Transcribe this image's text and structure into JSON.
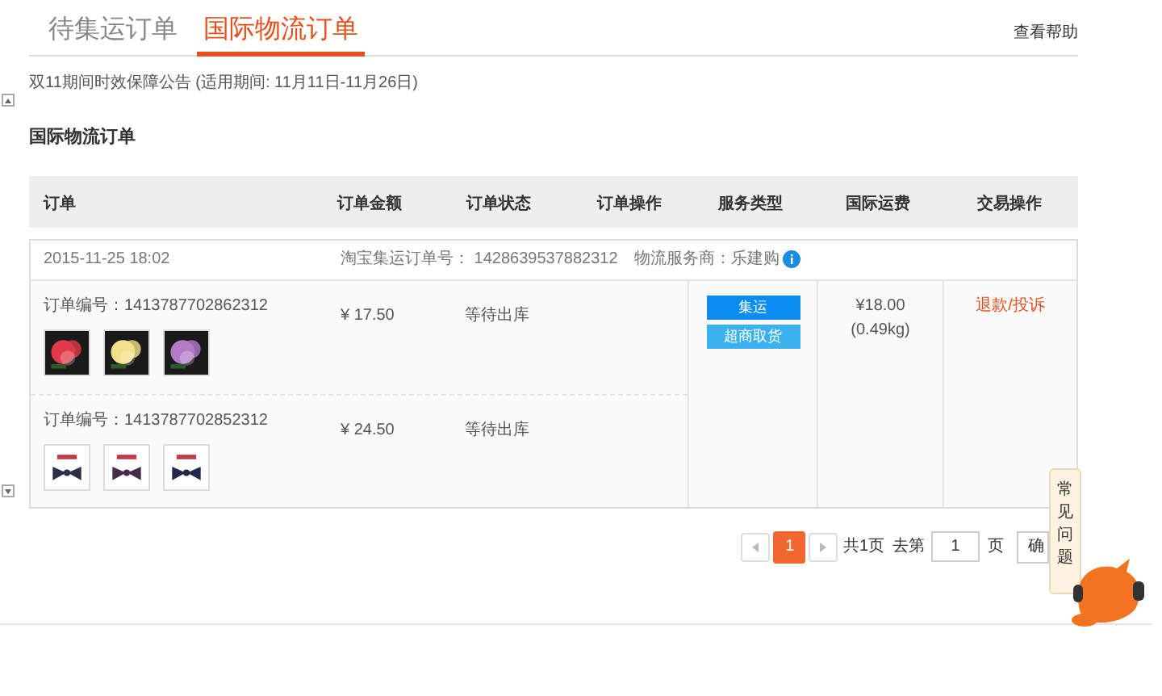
{
  "tabs": [
    {
      "label": "待集运订单",
      "selected": false
    },
    {
      "label": "国际物流订单",
      "selected": true
    }
  ],
  "help_link": "查看帮助",
  "notice": "双11期间时效保障公告 (适用期间: 11月11日-11月26日)",
  "section_title": "国际物流订单",
  "columns": [
    "订单",
    "订单金额",
    "订单状态",
    "订单操作",
    "服务类型",
    "国际运费",
    "交易操作"
  ],
  "orders": [
    {
      "time": "2015-11-25 18:02",
      "shipping_no": "淘宝集运订单号： 1428639537882312",
      "provider": "物流服务商：乐建购",
      "items": [
        {
          "order_no": "订单编号：1413787702862312",
          "amount": "¥ 17.50",
          "status": "等待出库"
        },
        {
          "order_no": "订单编号：1413787702852312",
          "amount": "¥ 24.50",
          "status": "等待出库"
        }
      ],
      "services": [
        {
          "label": "集运",
          "color": "#0b8cf0"
        },
        {
          "label": "超商取货",
          "color": "#3bb2f0"
        }
      ],
      "freight": "¥18.00",
      "weight": "(0.49kg)",
      "action": "退款/投诉"
    }
  ],
  "pager": {
    "pages": [
      {
        "label": "1",
        "selected": true
      }
    ],
    "total": "共1页",
    "goto": "去第",
    "page_input": "1",
    "page_unit": "页",
    "confirm": "确"
  },
  "faq": "常见问题"
}
